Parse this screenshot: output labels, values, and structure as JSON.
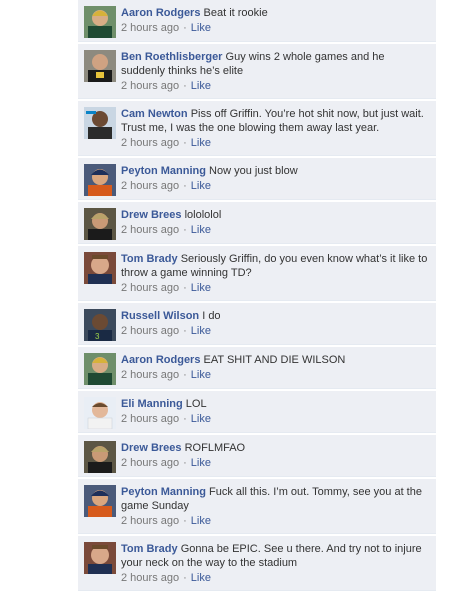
{
  "comments": [
    {
      "author": "Aaron Rodgers",
      "text": "Beat it rookie",
      "time": "2 hours ago",
      "like": "Like",
      "avatar": "aaron-rodgers-photo",
      "jersey": "#1f4a33",
      "helmet": "#d7b23a"
    },
    {
      "author": "Ben Roethlisberger",
      "text": "Guy wins 2 whole games and he suddenly thinks he’s elite",
      "time": "2 hours ago",
      "like": "Like",
      "avatar": "ben-roethlisberger-photo",
      "jersey": "#1a1a1a",
      "helmet": "#222222"
    },
    {
      "author": "Cam Newton",
      "text": "Piss off Griffin. You’re hot shit now, but just wait. Trust me, I was the one blowing them away last year.",
      "time": "2 hours ago",
      "like": "Like",
      "avatar": "cam-newton-photo",
      "jersey": "#2b2b2b",
      "helmet": "#0b84c7"
    },
    {
      "author": "Peyton Manning",
      "text": "Now you just blow",
      "time": "2 hours ago",
      "like": "Like",
      "avatar": "peyton-manning-photo",
      "jersey": "#d65a1c",
      "helmet": "#1d2f5a"
    },
    {
      "author": "Drew Brees",
      "text": "lolololol",
      "time": "2 hours ago",
      "like": "Like",
      "avatar": "drew-brees-photo",
      "jersey": "#1b1b1b",
      "helmet": "#b9a36a"
    },
    {
      "author": "Tom Brady",
      "text": "Seriously Griffin, do you even know what’s it like to throw a game winning TD?",
      "time": "2 hours ago",
      "like": "Like",
      "avatar": "tom-brady-photo",
      "jersey": "#1f2f52",
      "helmet": "#b0342e"
    },
    {
      "author": "Russell Wilson",
      "text": "I do",
      "time": "2 hours ago",
      "like": "Like",
      "avatar": "russell-wilson-photo",
      "jersey": "#1a2a44",
      "helmet": "#2e4a6b"
    },
    {
      "author": "Aaron Rodgers",
      "text": "EAT SHIT AND DIE WILSON",
      "time": "2 hours ago",
      "like": "Like",
      "avatar": "aaron-rodgers-photo",
      "jersey": "#1f4a33",
      "helmet": "#d7b23a"
    },
    {
      "author": "Eli Manning",
      "text": "LOL",
      "time": "2 hours ago",
      "like": "Like",
      "avatar": "eli-manning-photo",
      "jersey": "#f2f2f2",
      "helmet": "#1a3a8a"
    },
    {
      "author": "Drew Brees",
      "text": "ROFLMFAO",
      "time": "2 hours ago",
      "like": "Like",
      "avatar": "drew-brees-photo",
      "jersey": "#1b1b1b",
      "helmet": "#b9a36a"
    },
    {
      "author": "Peyton Manning",
      "text": "Fuck all this. I’m out. Tommy, see you at the game Sunday",
      "time": "2 hours ago",
      "like": "Like",
      "avatar": "peyton-manning-photo",
      "jersey": "#d65a1c",
      "helmet": "#1d2f5a"
    },
    {
      "author": "Tom Brady",
      "text": "Gonna be EPIC. See u there. And try not to injure your neck on the way to the stadium",
      "time": "2 hours ago",
      "like": "Like",
      "avatar": "tom-brady-photo",
      "jersey": "#1f2f52",
      "helmet": "#b0342e"
    }
  ],
  "separator": "·"
}
